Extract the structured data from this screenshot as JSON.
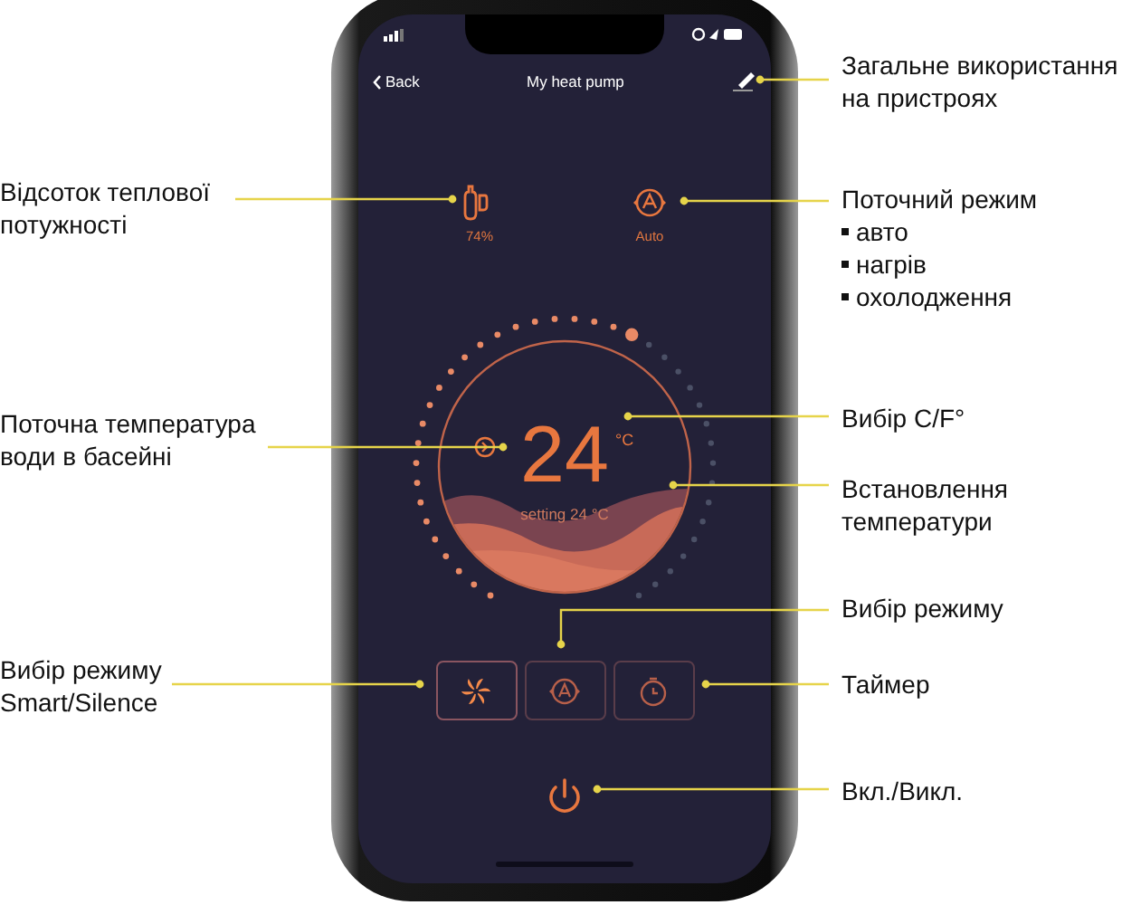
{
  "header": {
    "back": "Back",
    "title": "My heat pump"
  },
  "stats": [
    {
      "kind": "power",
      "value": "74%"
    },
    {
      "kind": "mode",
      "value": "Auto"
    }
  ],
  "dial": {
    "temperature": "24",
    "unit": "°C",
    "setting": "setting 24 °C"
  },
  "mode_buttons": [
    {
      "kind": "fan",
      "selected": true
    },
    {
      "kind": "auto",
      "selected": false
    },
    {
      "kind": "timer",
      "selected": false
    }
  ],
  "annotations": [
    {
      "text": "Загальне використання на пристроях"
    },
    {
      "text": "Відсоток теплової потужності"
    },
    {
      "text": "Поточний режим",
      "items": [
        "авто",
        "нагрів",
        "охолодження"
      ]
    },
    {
      "text": "Поточна температура води в басейні"
    },
    {
      "text": "Вибір C/F°"
    },
    {
      "text": "Встановлення температури"
    },
    {
      "text": "Вибір режиму"
    },
    {
      "text": "Вибір режиму Smart/Silence"
    },
    {
      "text": "Таймер"
    },
    {
      "text": "Вкл./Викл."
    }
  ]
}
